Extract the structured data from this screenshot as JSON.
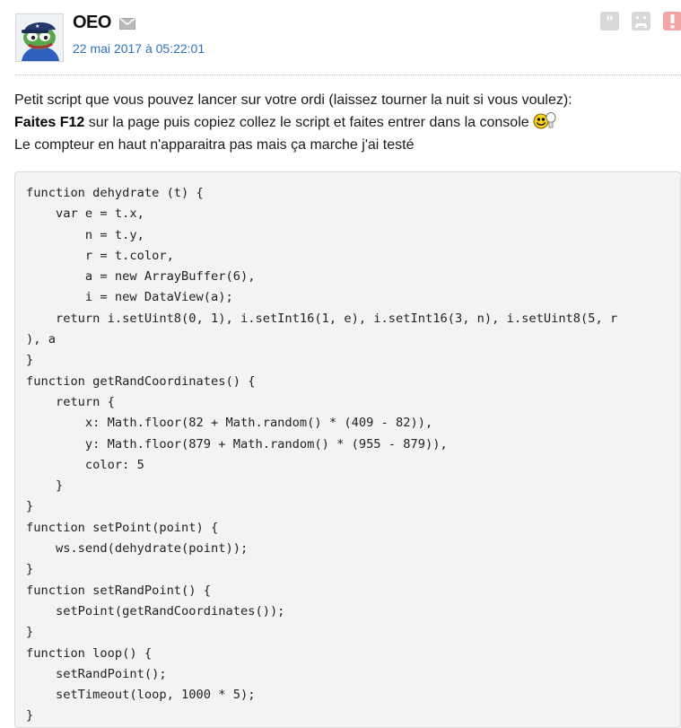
{
  "post": {
    "author": "OEO",
    "date": "22 mai 2017 à 05:22:01",
    "actions": {
      "quote_icon": "quote-icon",
      "ignore_icon": "sad-face-icon",
      "report_icon": "exclamation-icon",
      "mail_icon": "envelope-icon"
    },
    "avatar": "pepe-frog-with-cap-avatar"
  },
  "message": {
    "line1": "Petit script que vous pouvez lancer sur votre ordi (laissez tourner la nuit si vous voulez):",
    "line2_bold": "Faites F12",
    "line2_rest": " sur la page puis copiez collez le script et faites entrer dans la console",
    "line3": "Le compteur en haut n'apparaitra pas mais ça marche j'ai testé"
  },
  "code_lines": [
    "function dehydrate (t) {",
    "    var e = t.x,",
    "        n = t.y,",
    "        r = t.color,",
    "        a = new ArrayBuffer(6),",
    "        i = new DataView(a);",
    "    return i.setUint8(0, 1), i.setInt16(1, e), i.setInt16(3, n), i.setUint8(5, r",
    "), a",
    "}",
    "function getRandCoordinates() {",
    "    return {",
    "        x: Math.floor(82 + Math.random() * (409 - 82)),",
    "        y: Math.floor(879 + Math.random() * (955 - 879)),",
    "        color: 5",
    "    }",
    "}",
    "function setPoint(point) {",
    "    ws.send(dehydrate(point));",
    "}",
    "function setRandPoint() {",
    "    setPoint(getRandCoordinates());",
    "}",
    "function loop() {",
    "    setRandPoint();",
    "    setTimeout(loop, 1000 * 5);",
    "}"
  ],
  "colors": {
    "date_link": "#2e73b8",
    "report_button": "#f3a5a5",
    "action_button": "#d8d8d8",
    "code_background": "#f3f3f3"
  }
}
